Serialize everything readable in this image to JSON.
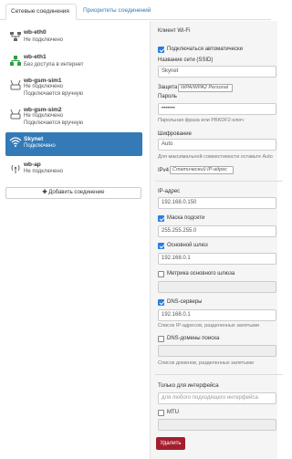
{
  "tabs": {
    "connections": "Сетевые соединения",
    "priorities": "Приоритеты соединений"
  },
  "connections": [
    {
      "name": "wb-eth0",
      "status": [
        "Не подключено"
      ],
      "icon": "ethernet-icon"
    },
    {
      "name": "wb-eth1",
      "status": [
        "Без доступа в интернет"
      ],
      "icon": "ethernet-connected-icon"
    },
    {
      "name": "wb-gsm-sim1",
      "status": [
        "Не подключено",
        "Подключается вручную"
      ],
      "icon": "modem-icon"
    },
    {
      "name": "wb-gsm-sim2",
      "status": [
        "Не подключено",
        "Подключается вручную"
      ],
      "icon": "modem-icon"
    },
    {
      "name": "Skynet",
      "status": [
        "Подключено"
      ],
      "icon": "wifi-icon",
      "selected": true
    },
    {
      "name": "wb-ap",
      "status": [
        "Не подключено"
      ],
      "icon": "access-point-icon"
    }
  ],
  "add_button": "Добавить соединение",
  "form": {
    "type_label": "Клиент Wi-Fi",
    "autoconnect_label": "Подключаться автоматически",
    "ssid_label": "Название сети (SSID)",
    "ssid_value": "Skynet",
    "security_label": "Защита",
    "security_value": "WPA/WPA2 Personal",
    "password_label": "Пароль",
    "password_value": "•••••••",
    "password_help": "Парольная фраза или PBKDF2-ключ",
    "encryption_label": "Шифрование",
    "encryption_value": "Auto",
    "encryption_help": "Для максимальной совместимости оставьте Auto",
    "ipv4_label": "IPv4",
    "ipv4_value": "Статический IP-адрес",
    "ip_label": "IP-адрес",
    "ip_value": "192.168.0.150",
    "netmask_label": "Маска подсети",
    "netmask_value": "255.255.255.0",
    "gateway_label": "Основной шлюз",
    "gateway_value": "192.168.0.1",
    "metric_label": "Метрика основного шлюза",
    "dns_label": "DNS-серверы",
    "dns_value": "192.168.0.1",
    "dns_help": "Список IP-адресов, разделенных запятыми",
    "domains_label": "DNS-домены поиска",
    "domains_help": "Список доменов, разделенных запятыми",
    "iface_label": "Только для интерфейса",
    "iface_placeholder": "для любого подходящего интерфейса",
    "mtu_label": "MTU",
    "delete_button": "Удалить"
  },
  "colors": {
    "accent": "#337ab7",
    "danger": "#a51d2d",
    "checkbox": "#2a7ee0"
  }
}
